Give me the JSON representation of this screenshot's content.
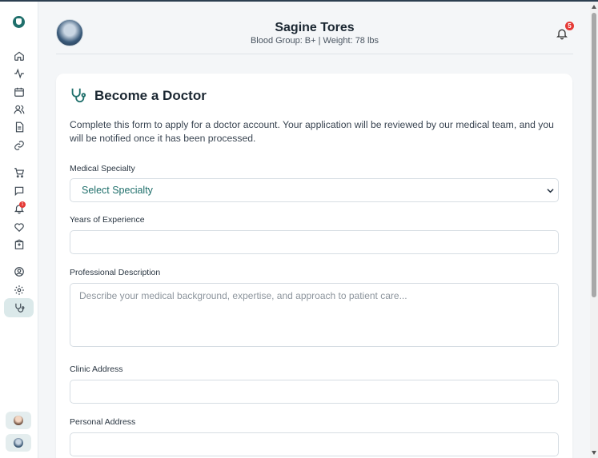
{
  "header": {
    "name": "Sagine Tores",
    "meta": "Blood Group: B+ | Weight: 78 lbs",
    "notification_count": "5"
  },
  "sidebar": {
    "items": [
      {
        "icon": "home-icon"
      },
      {
        "icon": "activity-icon"
      },
      {
        "icon": "calendar-icon"
      },
      {
        "icon": "users-icon"
      },
      {
        "icon": "document-icon"
      },
      {
        "icon": "link-icon"
      },
      {
        "icon": "cart-icon"
      },
      {
        "icon": "chat-icon"
      },
      {
        "icon": "bell-icon"
      },
      {
        "icon": "heart-icon"
      },
      {
        "icon": "hospital-icon"
      },
      {
        "icon": "profile-icon"
      },
      {
        "icon": "settings-icon"
      },
      {
        "icon": "stethoscope-icon",
        "active": true
      }
    ],
    "notification_badge": "1"
  },
  "form": {
    "title": "Become a Doctor",
    "description": "Complete this form to apply for a doctor account. Your application will be reviewed by our medical team, and you will be notified once it has been processed.",
    "specialty": {
      "label": "Medical Specialty",
      "value": "Select Specialty"
    },
    "experience": {
      "label": "Years of Experience",
      "value": ""
    },
    "description_field": {
      "label": "Professional Description",
      "placeholder": "Describe your medical background, expertise, and approach to patient care..."
    },
    "clinic_address": {
      "label": "Clinic Address",
      "value": ""
    },
    "personal_address": {
      "label": "Personal Address",
      "value": ""
    }
  },
  "colors": {
    "accent": "#1f6f6b",
    "badge": "#e53935"
  }
}
